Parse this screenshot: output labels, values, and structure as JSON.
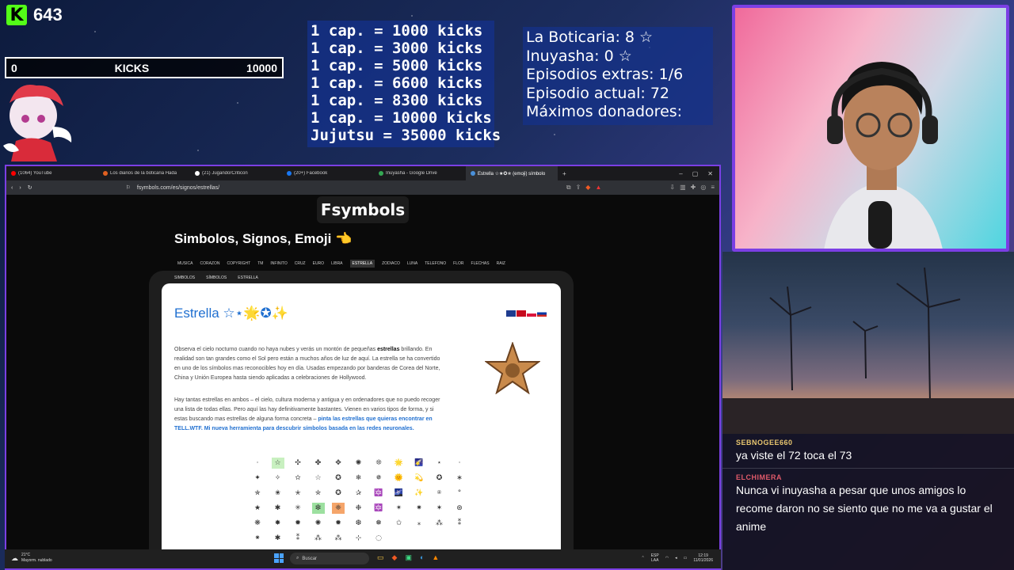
{
  "kick": {
    "count": "643",
    "bar_min": "0",
    "bar_label": "KICKS",
    "bar_max": "10000",
    "brand_color": "#53fc18"
  },
  "goals": [
    "1 cap. = 1000 kicks",
    "1 cap. = 3000 kicks",
    "1 cap. = 5000 kicks",
    "1 cap. = 6600 kicks",
    "1 cap. = 8300 kicks",
    "1 cap. = 10000 kicks",
    "Jujutsu = 35000 kicks"
  ],
  "stats": [
    "La Boticaria: 8 ☆",
    "Inuyasha: 0 ☆",
    "Episodios extras: 1/6",
    "Episodio actual: 72",
    "Máximos donadores:"
  ],
  "chat": [
    {
      "user": "SEBNOGEE660",
      "text": "ya viste el 72 toca el 73"
    },
    {
      "user": "ELCHIMERA",
      "text": "Nunca vi inuyasha a pesar que unos amigos lo recome daron no se siento que no me va a gustar el anime"
    }
  ],
  "browser": {
    "tabs": [
      {
        "label": "(1064) YouTube",
        "color": "#ff0000"
      },
      {
        "label": "Los diarios de la boticaria Hada",
        "color": "#e06020"
      },
      {
        "label": "(21) JugandorCriticon",
        "color": "#ffffff"
      },
      {
        "label": "(20+) Facebook",
        "color": "#1877f2"
      },
      {
        "label": "Inuyasha - Google Drive",
        "color": "#34a853"
      },
      {
        "label": "Estrella ☆★✪✯ (emoji) símbolo",
        "color": "#4a90d9"
      }
    ],
    "new_tab": "+",
    "url": "fsymbols.com/es/signos/estrellas/"
  },
  "site": {
    "logo": "Fsymbols",
    "title": "Simbolos, Signos, Emoji 👈",
    "categories": [
      "MUSICA",
      "CORAZON",
      "COPYRIGHT",
      "TM",
      "INFINITO",
      "CRUZ",
      "EURO",
      "LIBRA",
      "ESTRELLA",
      "ZODIACO",
      "LUNA",
      "TELEFONO",
      "FLOR",
      "FLECHAS",
      "RAIZ"
    ],
    "active_category": "ESTRELLA",
    "breadcrumb": [
      "SIMBOLOS",
      "SÍMBOLOS",
      "ESTRELLA"
    ],
    "heading": "Estrella ☆⋆🌟✪✨",
    "para1_a": "Observa el cielo nocturno cuando no haya nubes y verás un montón de pequeñas ",
    "para1_b": "estrellas",
    "para1_c": " brillando. En realidad son tan grandes como el Sol pero están a muchos años de luz de aquí. La estrella se ha convertido en uno de los símbolos mas reconocibles hoy en día. Usadas empezando por banderas de Corea del Norte, China y Unión Europea hasta siendo aplicadas a celebraciones de Hollywood.",
    "para2_a": "Hay tantas estrellas en ambos – el cielo, cultura moderna y antigua y en ordenadores que no puedo recoger una lista de todas ellas. Pero aquí las hay definitivamente bastantes. Vienen en varios tipos de forma, y si estas buscando mas estrellas de alguna forma concreta – ",
    "para2_link": "pinta las estrellas que quieras encontrar en TELL.WTF. Mi nueva herramienta para descubrir símbolos basada en las redes neuronales.",
    "symbols": [
      "·",
      "☆",
      "✣",
      "✤",
      "✥",
      "✺",
      "❊",
      "🌟",
      "🌠",
      "⋆",
      "·",
      "✦",
      "✧",
      "✫",
      "☆",
      "✪",
      "❄",
      "✵",
      "🌞",
      "💫",
      "✪",
      "∗",
      "✯",
      "✬",
      "✭",
      "✮",
      "✪",
      "✰",
      "🔯",
      "🌌",
      "✨",
      "⍟",
      "°",
      "★",
      "✱",
      "✳",
      "❇",
      "❈",
      "❉",
      "🔯",
      "✴",
      "✷",
      "✶",
      "⊛",
      "❋",
      "✸",
      "✹",
      "✺",
      "✹",
      "❆",
      "❅",
      "✩",
      "⁎",
      "⁂",
      "⁑",
      "⁕",
      "✱",
      "⁑",
      "⁂",
      "⁂",
      "⊹",
      "◌"
    ]
  },
  "taskbar": {
    "temp": "21°C",
    "weather": "Mayorm. nublado",
    "search": "Buscar",
    "lang": "ESP",
    "lang2": "LAA",
    "time": "12:19",
    "date": "11/01/2026"
  }
}
